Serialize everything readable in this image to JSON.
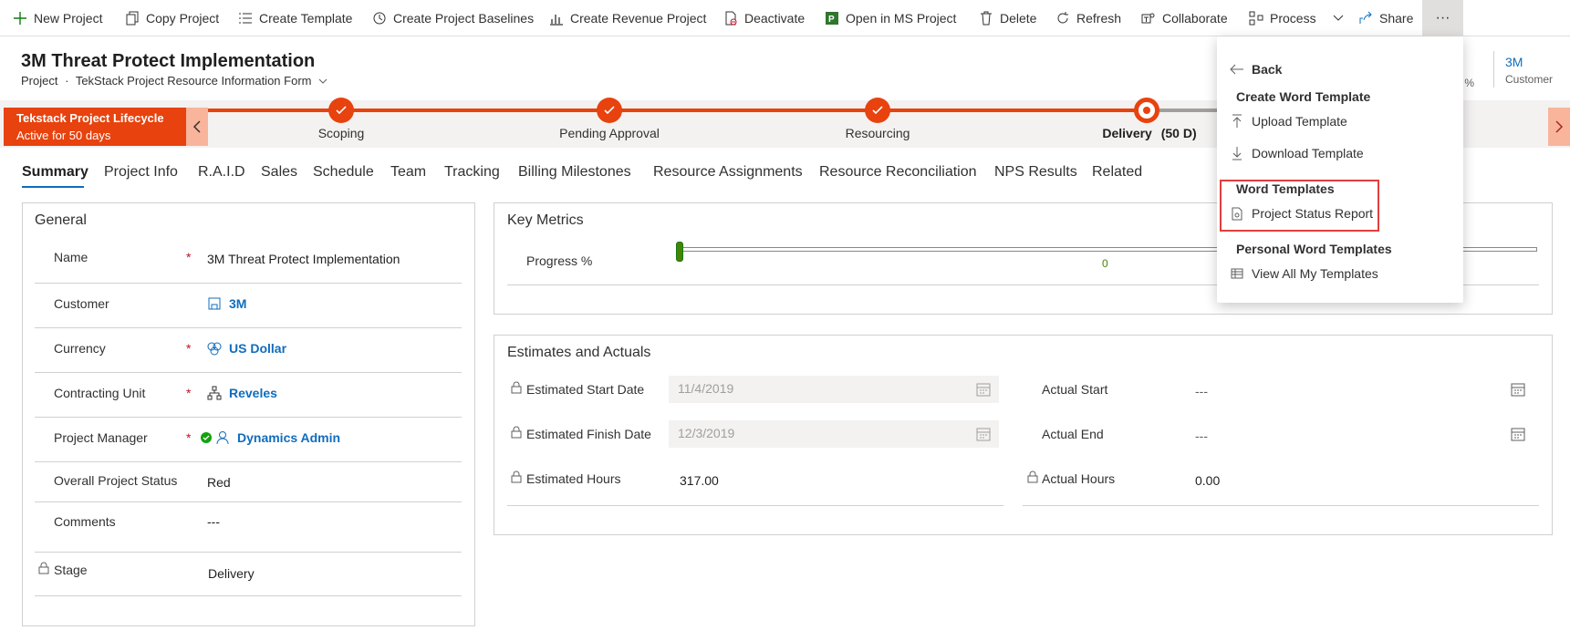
{
  "commandbar": {
    "items": [
      {
        "label": "New Project",
        "icon": "plus-icon"
      },
      {
        "label": "Copy Project",
        "icon": "copy-icon"
      },
      {
        "label": "Create Template",
        "icon": "list-icon"
      },
      {
        "label": "Create Project Baselines",
        "icon": "history-icon"
      },
      {
        "label": "Create Revenue Project",
        "icon": "bar-chart-icon"
      },
      {
        "label": "Deactivate",
        "icon": "deactivate-icon"
      },
      {
        "label": "Open in MS Project",
        "icon": "ms-project-icon"
      },
      {
        "label": "Delete",
        "icon": "trash-icon"
      },
      {
        "label": "Refresh",
        "icon": "refresh-icon"
      },
      {
        "label": "Collaborate",
        "icon": "teams-icon"
      },
      {
        "label": "Process",
        "icon": "process-icon"
      },
      {
        "label": "Share",
        "icon": "share-icon"
      }
    ],
    "more_label": "···"
  },
  "header": {
    "title": "3M Threat Protect Implementation",
    "entity": "Project",
    "separator": "·",
    "form_name": "TekStack Project Resource Information Form",
    "fields": [
      {
        "value": "ss %",
        "label": ""
      },
      {
        "value": "3M",
        "label": "Customer"
      }
    ]
  },
  "bpf": {
    "name": "Tekstack Project Lifecycle",
    "active_for": "Active for 50 days",
    "stages": [
      {
        "label": "Scoping",
        "done": true
      },
      {
        "label": "Pending Approval",
        "done": true
      },
      {
        "label": "Resourcing",
        "done": true
      },
      {
        "label": "Delivery",
        "duration": "(50 D)",
        "active": true
      }
    ]
  },
  "tabs": [
    "Summary",
    "Project Info",
    "R.A.I.D",
    "Sales",
    "Schedule",
    "Team",
    "Tracking",
    "Billing Milestones",
    "Resource Assignments",
    "Resource Reconciliation",
    "NPS Results",
    "Related"
  ],
  "general": {
    "title": "General",
    "required_mark": "*",
    "name": {
      "label": "Name",
      "value": "3M Threat Protect Implementation"
    },
    "customer": {
      "label": "Customer",
      "value": "3M"
    },
    "currency": {
      "label": "Currency",
      "value": "US Dollar"
    },
    "contracting_unit": {
      "label": "Contracting Unit",
      "value": "Reveles"
    },
    "project_manager": {
      "label": "Project Manager",
      "value": "Dynamics Admin"
    },
    "status": {
      "label": "Overall Project Status",
      "value": "Red"
    },
    "comments": {
      "label": "Comments",
      "value": "---"
    },
    "stage": {
      "label": "Stage",
      "value": "Delivery"
    }
  },
  "key_metrics": {
    "title": "Key Metrics",
    "progress_label": "Progress %",
    "progress_value": "0",
    "progress_fraction": 0
  },
  "estimates": {
    "title": "Estimates and Actuals",
    "est_start": {
      "label": "Estimated Start Date",
      "value": "11/4/2019"
    },
    "est_finish": {
      "label": "Estimated Finish Date",
      "value": "12/3/2019"
    },
    "est_hours": {
      "label": "Estimated Hours",
      "value": "317.00"
    },
    "actual_start": {
      "label": "Actual Start",
      "value": "---"
    },
    "actual_end": {
      "label": "Actual End",
      "value": "---"
    },
    "actual_hours": {
      "label": "Actual Hours",
      "value": "0.00"
    }
  },
  "menu": {
    "back": "Back",
    "create_header": "Create Word Template",
    "upload": "Upload Template",
    "download": "Download Template",
    "word_header": "Word Templates",
    "status_report": "Project Status Report",
    "personal_header": "Personal Word Templates",
    "view_all": "View All My Templates"
  },
  "colors": {
    "accent": "#e8420e",
    "link": "#0f6cbd",
    "highlight": "#e03e3e"
  }
}
